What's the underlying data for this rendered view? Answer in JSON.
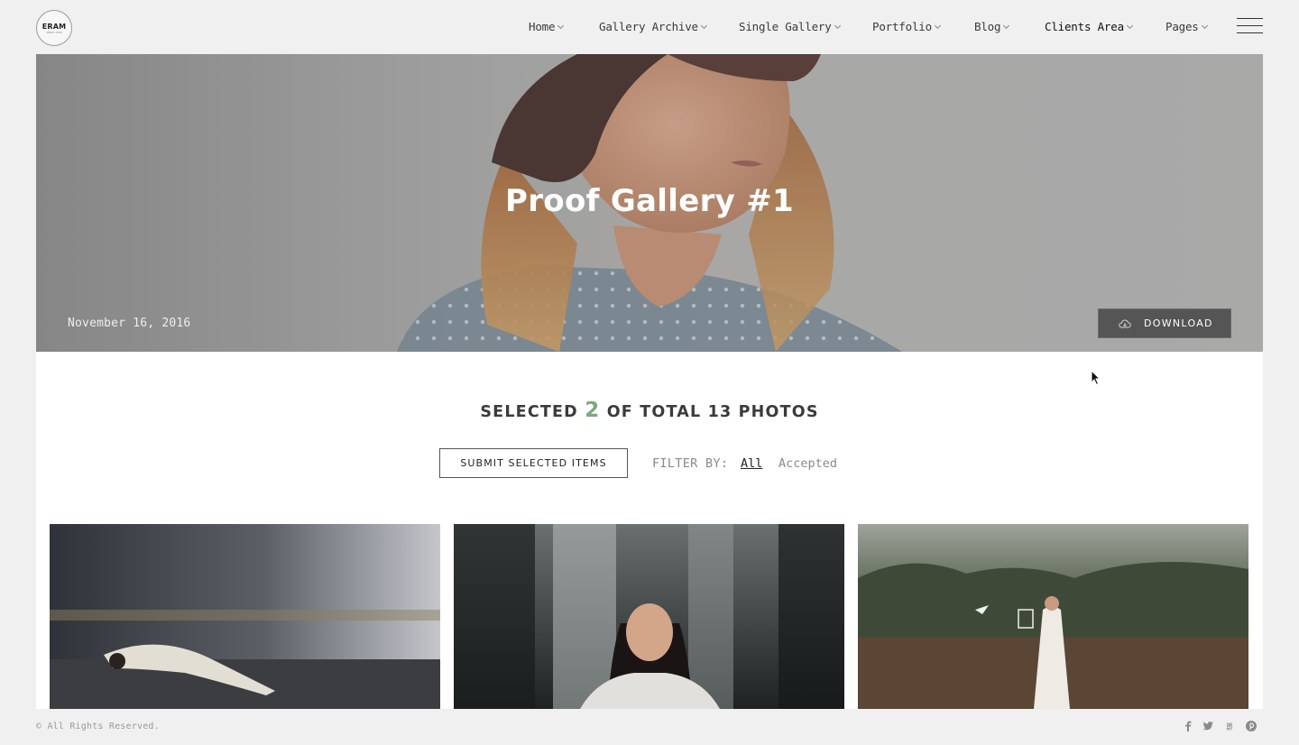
{
  "logo": {
    "word": "ERAM",
    "sub": "SINCE 1990"
  },
  "nav": {
    "items": [
      {
        "label": "Home"
      },
      {
        "label": "Gallery Archive"
      },
      {
        "label": "Single Gallery"
      },
      {
        "label": "Portfolio"
      },
      {
        "label": "Blog"
      },
      {
        "label": "Clients Area"
      },
      {
        "label": "Pages"
      }
    ],
    "menu_icon": "hamburger-menu-icon"
  },
  "hero": {
    "title": "Proof Gallery #1",
    "date": "November 16, 2016",
    "download_label": "DOWNLOAD",
    "download_icon": "cloud-download-icon"
  },
  "selection": {
    "prefix": "SELECTED",
    "selected_count": "2",
    "suffix": "OF TOTAL 13 PHOTOS"
  },
  "actions": {
    "submit_label": "SUBMIT SELECTED ITEMS"
  },
  "filter": {
    "label": "FILTER BY:",
    "options": [
      "All",
      "Accepted"
    ],
    "active": "All"
  },
  "footer": {
    "copyright": "© All Rights Reserved.",
    "social_icons": [
      "facebook-icon",
      "twitter-icon",
      "500px-icon",
      "pinterest-icon"
    ]
  },
  "colors": {
    "accent_green": "#7aa97a",
    "download_bg": "#555555",
    "page_bg": "#f0f0f0"
  }
}
